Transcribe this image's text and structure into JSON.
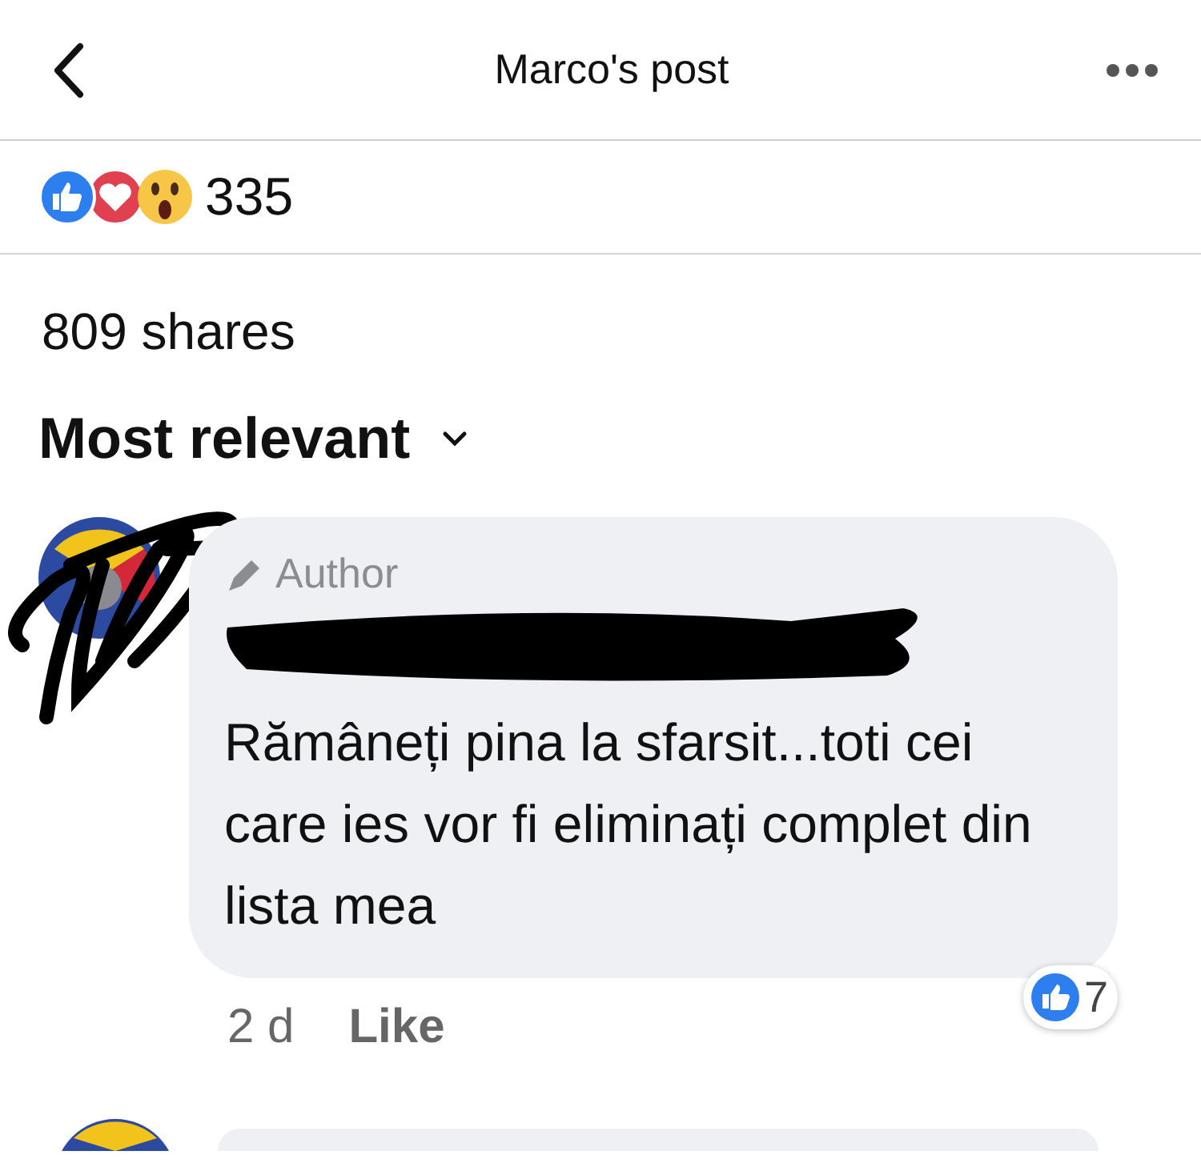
{
  "header": {
    "title": "Marco's post"
  },
  "reactions": {
    "count": "335"
  },
  "shares": "809 shares",
  "sort": {
    "label": "Most relevant"
  },
  "comments": [
    {
      "badge": "Author",
      "text": "Rămâneți pina la sfarsit...toti cei care ies vor fi eliminați complet din lista mea",
      "time": "2 d",
      "like": "Like",
      "reaction_count": "7"
    }
  ]
}
